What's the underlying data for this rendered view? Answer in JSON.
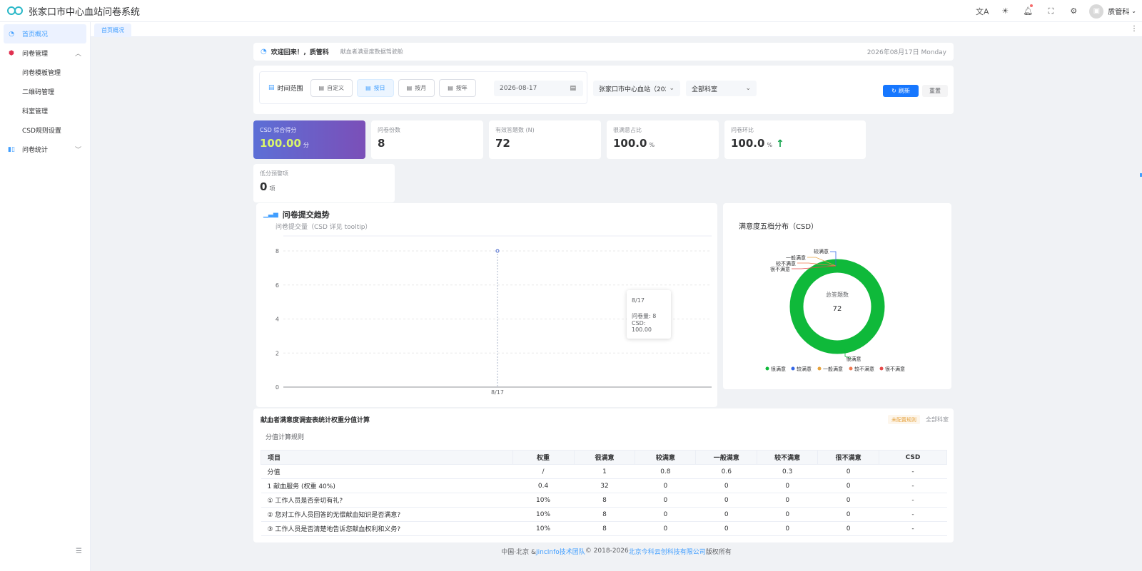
{
  "header": {
    "title": "张家口市中心血站问卷系统",
    "icons": [
      "translate-icon",
      "theme-icon",
      "bell-icon",
      "fullscreen-icon",
      "settings-icon"
    ],
    "user": "质管科"
  },
  "sidebar": {
    "items": [
      {
        "label": "首页概况",
        "icon": "dashboard-icon"
      },
      {
        "label": "问卷管理",
        "icon": "survey-icon"
      },
      {
        "label": "问卷模板管理"
      },
      {
        "label": "二维码管理"
      },
      {
        "label": "科室管理"
      },
      {
        "label": "CSD规则设置"
      },
      {
        "label": "问卷统计",
        "icon": "stats-icon"
      }
    ]
  },
  "tabs": [
    {
      "label": "首页概况"
    }
  ],
  "welcome": {
    "title": "欢迎回来！，质管科",
    "subtitle": "献血者满意度数据驾驶舱",
    "date": "2026年08月17日 Monday"
  },
  "filter": {
    "range_label": "时间范围",
    "buttons": [
      "自定义",
      "按日",
      "按月",
      "按年"
    ],
    "selected": "按日",
    "date": "2026-08-17",
    "station": "张家口市中心血站（202",
    "dept": "全部科室",
    "refresh": "刷新",
    "reset": "重置"
  },
  "stats": [
    {
      "label": "CSD 综合得分",
      "value": "100.00",
      "unit": "分"
    },
    {
      "label": "问卷份数",
      "value": "8",
      "unit": ""
    },
    {
      "label": "有效答题数 (N)",
      "value": "72",
      "unit": ""
    },
    {
      "label": "很满意占比",
      "value": "100.0",
      "unit": "%"
    },
    {
      "label": "问卷环比",
      "value": "100.0",
      "unit": "%"
    },
    {
      "label": "低分预警项",
      "value": "0",
      "unit": "项"
    }
  ],
  "chart_data": [
    {
      "type": "line",
      "title": "问卷提交趋势",
      "subtitle": "问卷提交量（CSD 详见 tooltip）",
      "x": [
        "8/17"
      ],
      "series": [
        {
          "values": [
            8
          ]
        }
      ],
      "yticks": [
        "0",
        "2",
        "4",
        "6",
        "8"
      ],
      "ylim": [
        0,
        8
      ],
      "grid": true,
      "tooltip": {
        "date": "8/17",
        "count_line": "问卷量: 8",
        "csd_line": "CSD: 100.00"
      }
    },
    {
      "type": "pie",
      "title": "满意度五档分布（CSD）",
      "center_label": "总答题数",
      "center_value": "72",
      "categories": [
        "很满意",
        "较满意",
        "一般满意",
        "较不满意",
        "很不满意"
      ],
      "values": [
        72,
        0,
        0,
        0,
        0
      ],
      "colors": [
        "#0fb93a",
        "#3366e6",
        "#e6a23c",
        "#f07850",
        "#e64a4a"
      ],
      "legend": "bottom"
    }
  ],
  "table": {
    "title": "献血者满意度调查表统计权重分值计算",
    "tag": "未配置规则",
    "dept": "全部科室",
    "sub": "分值计算规则",
    "headers": [
      "项目",
      "权重",
      "很满意",
      "较满意",
      "一般满意",
      "较不满意",
      "很不满意",
      "CSD"
    ],
    "rows": [
      [
        "分值",
        "/",
        "1",
        "0.8",
        "0.6",
        "0.3",
        "0",
        "-"
      ],
      [
        "1 献血服务 (权重 40%)",
        "0.4",
        "32",
        "0",
        "0",
        "0",
        "0",
        "-"
      ],
      [
        "① 工作人员是否亲切有礼?",
        "10%",
        "8",
        "0",
        "0",
        "0",
        "0",
        "-"
      ],
      [
        "② 您对工作人员回答的无偿献血知识是否满意?",
        "10%",
        "8",
        "0",
        "0",
        "0",
        "0",
        "-"
      ],
      [
        "③ 工作人员是否清楚地告诉您献血权利和义务?",
        "10%",
        "8",
        "0",
        "0",
        "0",
        "0",
        "-"
      ]
    ]
  },
  "footer": {
    "prefix": "中国·北京 & ",
    "team": "JincInfo技术团队",
    "middle": " © 2018-2026 ",
    "company": "北京今科云创科技有限公司",
    "suffix": " 版权所有"
  },
  "colors": {
    "accent": "#409eff",
    "primary_button": "#1677ff",
    "success": "#0fb93a"
  }
}
